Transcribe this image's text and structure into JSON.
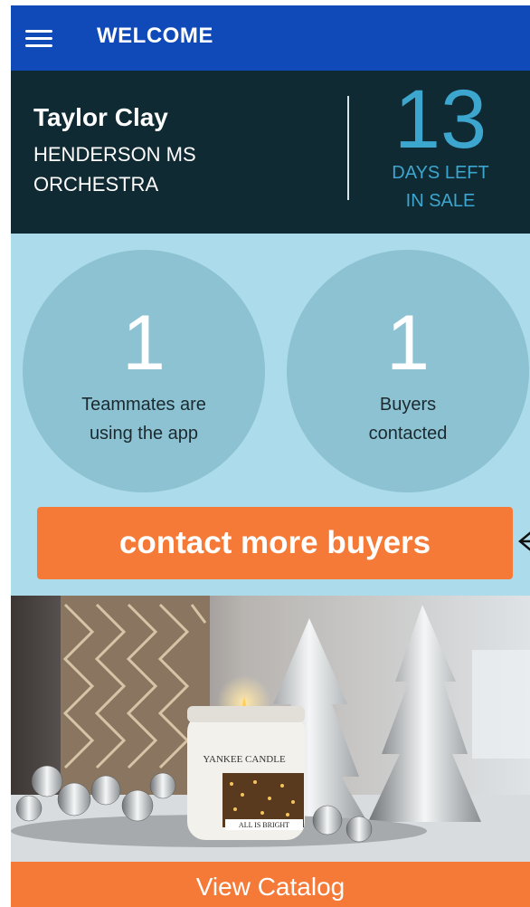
{
  "topbar": {
    "title": "WELCOME",
    "menu_icon": "hamburger-menu-icon"
  },
  "header": {
    "name": "Taylor Clay",
    "team_line1": "HENDERSON MS",
    "team_line2": "ORCHESTRA",
    "days_left": "13",
    "days_label1": "DAYS LEFT",
    "days_label2": "IN SALE"
  },
  "stats": [
    {
      "value": "1",
      "label1": "Teammates are",
      "label2": "using the app"
    },
    {
      "value": "1",
      "label1": "Buyers",
      "label2": "contacted"
    }
  ],
  "cta": {
    "label": "contact more buyers"
  },
  "photo": {
    "candle_brand": "YANKEE CANDLE",
    "candle_name": "ALL IS BRIGHT"
  },
  "footer": {
    "label": "View Catalog"
  },
  "colors": {
    "topbar": "#1049b8",
    "header_bg": "#0f2a33",
    "days_accent": "#3da6cf",
    "stats_bg": "#acdceb",
    "circle": "#8dc2d2",
    "orange": "#f57a38"
  }
}
